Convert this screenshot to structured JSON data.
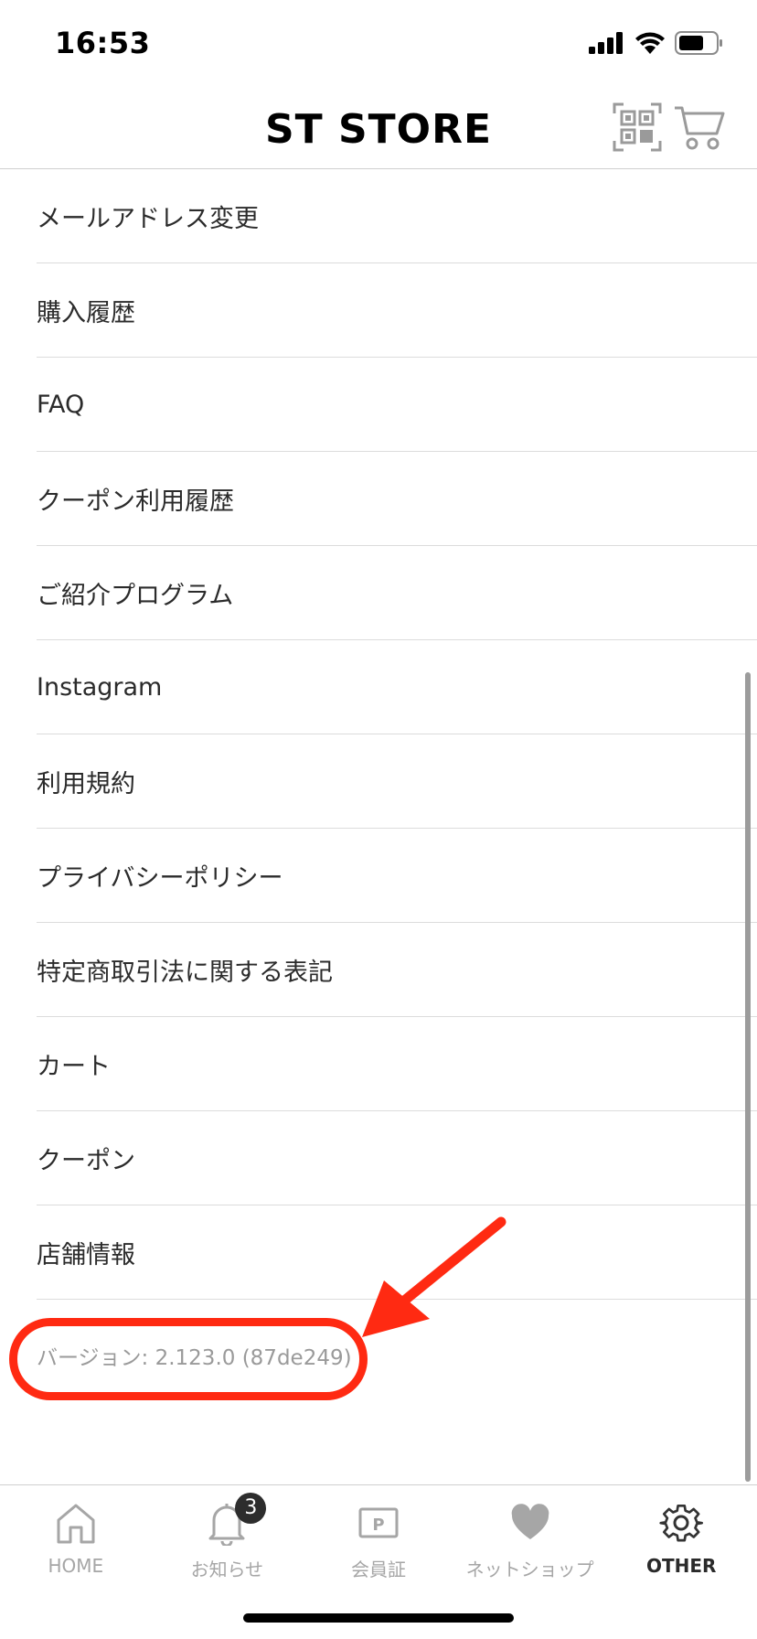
{
  "status_bar": {
    "time": "16:53"
  },
  "header": {
    "title": "ST STORE",
    "qr_icon": "qr-code-icon",
    "cart_icon": "cart-icon"
  },
  "menu": {
    "items": [
      {
        "label": "メールアドレス変更"
      },
      {
        "label": "購入履歴"
      },
      {
        "label": "FAQ"
      },
      {
        "label": "クーポン利用履歴"
      },
      {
        "label": "ご紹介プログラム"
      },
      {
        "label": "Instagram"
      },
      {
        "label": "利用規約"
      },
      {
        "label": "プライバシーポリシー"
      },
      {
        "label": "特定商取引法に関する表記"
      },
      {
        "label": "カート"
      },
      {
        "label": "クーポン"
      },
      {
        "label": "店舗情報"
      }
    ],
    "version": "バージョン: 2.123.0 (87de249)"
  },
  "annotation": {
    "color": "#ff2a12"
  },
  "tab_bar": {
    "tabs": [
      {
        "label": "HOME",
        "icon": "home-icon"
      },
      {
        "label": "お知らせ",
        "icon": "bell-icon",
        "badge": "3"
      },
      {
        "label": "会員証",
        "icon": "member-card-icon"
      },
      {
        "label": "ネットショップ",
        "icon": "heart-icon"
      },
      {
        "label": "OTHER",
        "icon": "gear-icon",
        "active": true
      }
    ]
  }
}
